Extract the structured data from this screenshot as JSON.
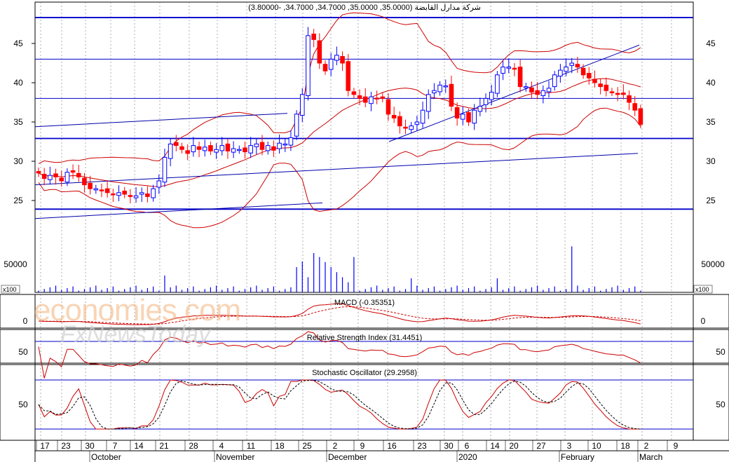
{
  "title": "شركة مدارل القابضة (35.0000, 35.0000, 34.7000, 34.7000, -3.80000)",
  "watermark": {
    "line1": "economies.com",
    "line2": "FxNewsToday"
  },
  "chart_data": [
    {
      "type": "candlestick",
      "panel": "price",
      "title": "شركة مدارل القابضة (35.0000, 35.0000, 34.7000, 34.7000, -3.80000)",
      "ohlc_last": {
        "open": 35.0,
        "high": 35.0,
        "low": 34.7,
        "close": 34.7,
        "change": -3.8
      },
      "ylim": [
        22.5,
        49
      ],
      "y_ticks": [
        25,
        30,
        35,
        40,
        45
      ],
      "closes": [
        28.5,
        27.8,
        28.2,
        28.0,
        27.5,
        28.6,
        28.6,
        28.0,
        27.0,
        26.5,
        26.5,
        26.3,
        26.0,
        25.8,
        26.0,
        25.8,
        25.5,
        25.6,
        26.0,
        25.5,
        26.5,
        27.5,
        30.5,
        32.2,
        32.0,
        31.5,
        31.0,
        32.0,
        31.5,
        31.8,
        31.3,
        31.5,
        32.0,
        31.3,
        31.6,
        31.5,
        31.2,
        32.0,
        32.2,
        31.5,
        32.0,
        31.4,
        32.3,
        32.2,
        33.0,
        36.0,
        38.5,
        46.0,
        45.5,
        42.5,
        41.5,
        43.0,
        43.5,
        42.5,
        39.0,
        38.5,
        38.0,
        37.5,
        38.2,
        38.0,
        38.0,
        36.0,
        35.5,
        34.5,
        34.2,
        34.5,
        35.0,
        36.5,
        38.5,
        39.0,
        39.7,
        39.6,
        37.0,
        35.5,
        36.0,
        35.0,
        36.5,
        37.0,
        38.0,
        38.8,
        41.0,
        42.0,
        42.0,
        41.8,
        39.5,
        39.5,
        38.8,
        38.5,
        39.0,
        39.3,
        41.0,
        41.6,
        42.0,
        42.5,
        42.0,
        41.0,
        40.6,
        40.0,
        39.5,
        39.0,
        38.8,
        38.5,
        38.5,
        37.5,
        36.5,
        34.7
      ],
      "overlays": [
        "Bollinger Bands (red)",
        "Trend lines (blue)"
      ],
      "horizontal_levels": [
        48.3,
        43.0,
        38.0,
        32.9,
        23.9
      ],
      "x_tick_labels": [
        "17",
        "23",
        "30",
        "7",
        "14",
        "21",
        "28",
        "4",
        "11",
        "18",
        "25",
        "2",
        "9",
        "16",
        "23",
        "30",
        "6",
        "14",
        "20",
        "27",
        "3",
        "10",
        "18",
        "2",
        "9"
      ],
      "month_labels": [
        "October",
        "November",
        "December",
        "2020",
        "February",
        "March"
      ]
    },
    {
      "type": "bar",
      "panel": "volume",
      "y_ticks": [
        50000
      ],
      "scale_label": "x100",
      "notes": "Volume spikes up to ~80000 around late November and late January"
    },
    {
      "type": "line",
      "panel": "MACD",
      "title": "MACD (-0.35351)",
      "y_ticks": [
        0
      ],
      "last_value": -0.35351
    },
    {
      "type": "line",
      "panel": "RSI",
      "title": "Relative Strength Index (31.4451)",
      "y_ticks": [
        50
      ],
      "last_value": 31.4451
    },
    {
      "type": "line",
      "panel": "Stochastic",
      "title": "Stochastic Oscillator (29.2958)",
      "y_ticks": [
        50
      ],
      "last_value": 29.2958
    }
  ],
  "labels": {
    "price_ticks": [
      "45",
      "40",
      "35",
      "30",
      "25"
    ],
    "volume_tick": "50000",
    "volume_scale": "x100",
    "macd_tick": "0",
    "rsi_tick": "50",
    "stoch_tick": "50",
    "macd_title": "MACD (-0.35351)",
    "rsi_title": "Relative Strength Index (31.4451)",
    "stoch_title": "Stochastic Oscillator (29.2958)"
  },
  "colors": {
    "up": "#0000ff",
    "down": "#ff0000",
    "band": "#cc0000",
    "trend": "#0000aa",
    "level": "#0000cc",
    "grid": "#000000"
  }
}
